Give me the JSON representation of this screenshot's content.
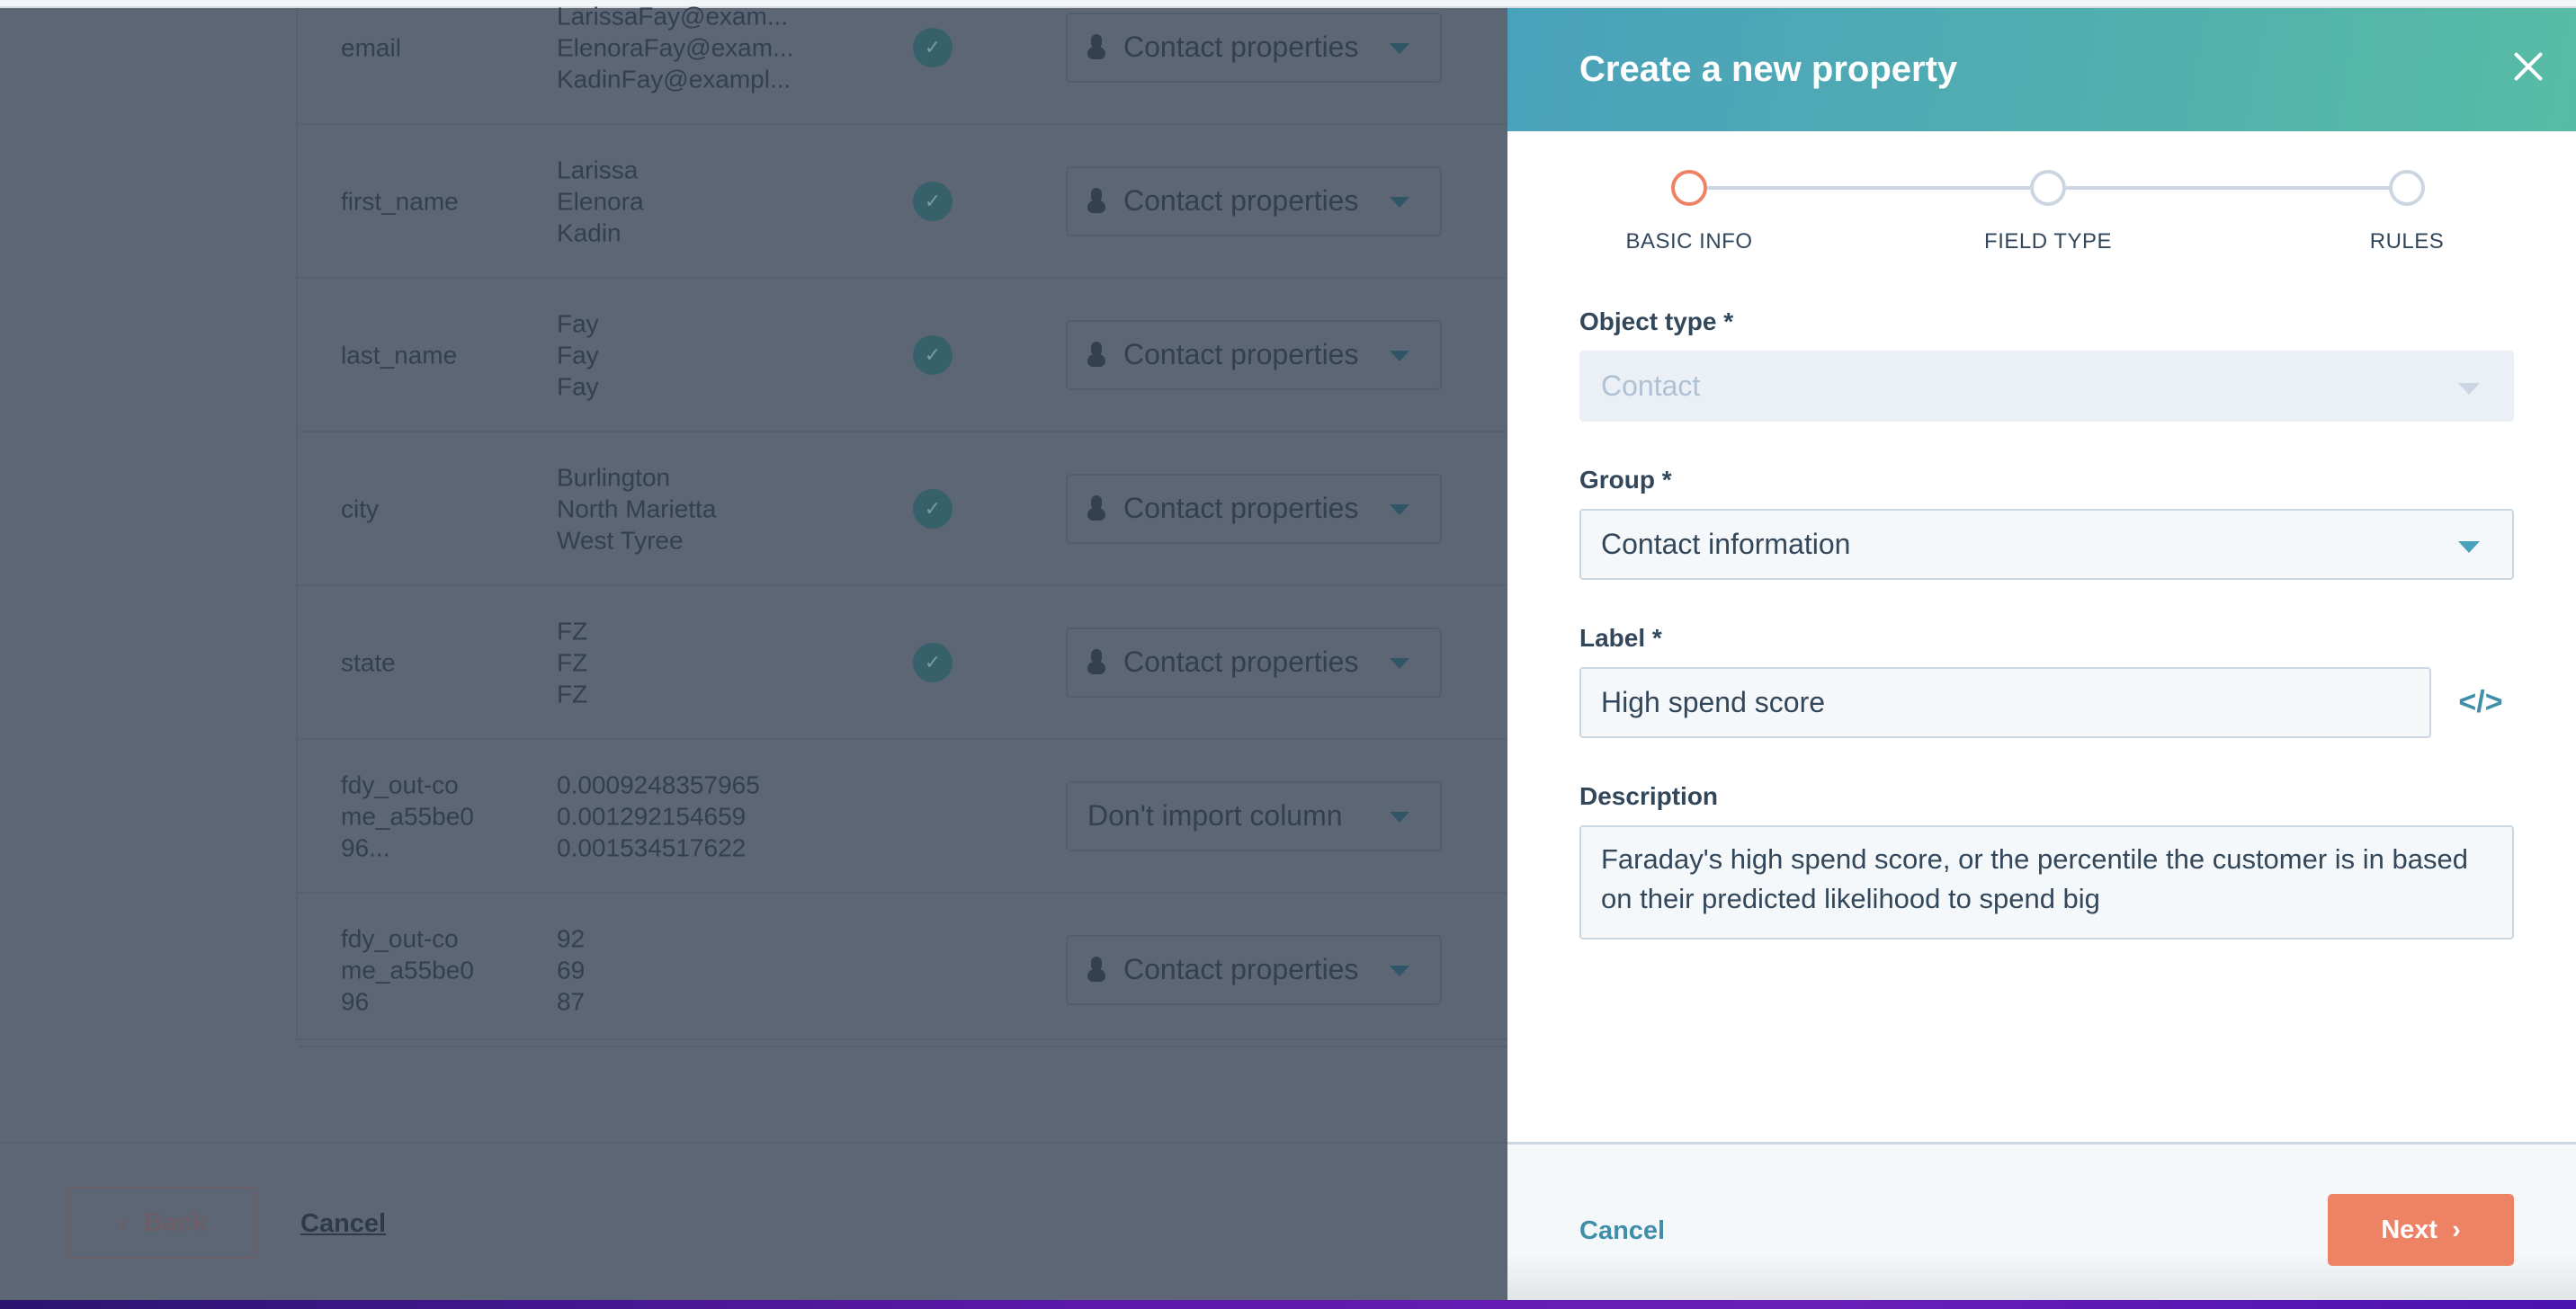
{
  "background": {
    "rows": [
      {
        "field": "email",
        "values": [
          "LarissaFay@exam...",
          "ElenoraFay@exam...",
          "KadinFay@exampl..."
        ],
        "matched": true,
        "mapping": "Contact properties",
        "mapping_icon": "person-icon"
      },
      {
        "field": "first_name",
        "values": [
          "Larissa",
          "Elenora",
          "Kadin"
        ],
        "matched": true,
        "mapping": "Contact properties",
        "mapping_icon": "person-icon"
      },
      {
        "field": "last_name",
        "values": [
          "Fay",
          "Fay",
          "Fay"
        ],
        "matched": true,
        "mapping": "Contact properties",
        "mapping_icon": "person-icon"
      },
      {
        "field": "city",
        "values": [
          "Burlington",
          "North Marietta",
          "West Tyree"
        ],
        "matched": true,
        "mapping": "Contact properties",
        "mapping_icon": "person-icon"
      },
      {
        "field": "state",
        "values": [
          "FZ",
          "FZ",
          "FZ"
        ],
        "matched": true,
        "mapping": "Contact properties",
        "mapping_icon": "person-icon"
      },
      {
        "field": "fdy_out-come_a55be096...",
        "values": [
          "0.0009248357965",
          "0.001292154659",
          "0.001534517622"
        ],
        "matched": false,
        "mapping": "Don't import column",
        "mapping_icon": ""
      },
      {
        "field": "fdy_out-come_a55be096",
        "values": [
          "92",
          "69",
          "87"
        ],
        "matched": false,
        "mapping": "Contact properties",
        "mapping_icon": "person-icon"
      }
    ],
    "footer": {
      "back_label": "Back",
      "cancel_label": "Cancel"
    }
  },
  "panel": {
    "title": "Create a new property",
    "close_icon": "close-icon",
    "steps": [
      {
        "label": "BASIC INFO",
        "active": true
      },
      {
        "label": "FIELD TYPE",
        "active": false
      },
      {
        "label": "RULES",
        "active": false
      }
    ],
    "object_type": {
      "label": "Object type *",
      "value": "Contact",
      "disabled": true
    },
    "group": {
      "label": "Group *",
      "value": "Contact information"
    },
    "label_field": {
      "label": "Label *",
      "value": "High spend score",
      "icon": "code-icon"
    },
    "description": {
      "label": "Description",
      "value": "Faraday's high spend score, or the percentile the customer is in based on their predicted likelihood to spend big"
    },
    "footer": {
      "cancel_label": "Cancel",
      "next_label": "Next"
    }
  },
  "colors": {
    "accent_teal": "#4aa1bc",
    "accent_orange": "#ee8265",
    "text_dark": "#33475b",
    "overlay": "#5c6675"
  }
}
